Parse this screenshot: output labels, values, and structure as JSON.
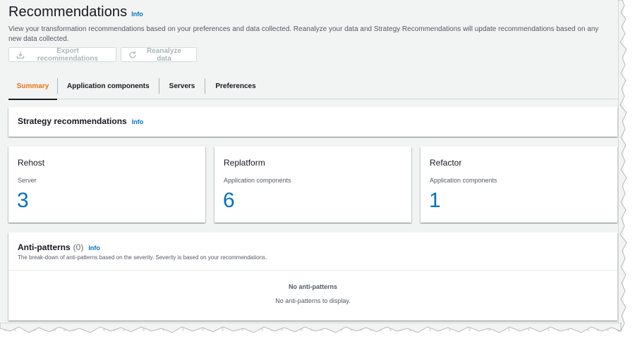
{
  "header": {
    "title": "Recommendations",
    "info": "Info",
    "description": "View your transformation recommendations based on your preferences and data collected. Reanalyze your data and Strategy Recommendations will update recommendations based on any new data collected."
  },
  "actions": {
    "export_label": "Export recommendations",
    "export_icon": "download-icon",
    "reanalyze_label": "Reanalyze data",
    "reanalyze_icon": "refresh-icon",
    "disabled_color": "#aab7b8"
  },
  "tabs": [
    {
      "label": "Summary",
      "active": true
    },
    {
      "label": "Application components",
      "active": false
    },
    {
      "label": "Servers",
      "active": false
    },
    {
      "label": "Preferences",
      "active": false
    }
  ],
  "strategy": {
    "title": "Strategy recommendations",
    "info": "Info"
  },
  "cards": [
    {
      "title": "Rehost",
      "subtitle": "Server",
      "value": "3"
    },
    {
      "title": "Replatform",
      "subtitle": "Application components",
      "value": "6"
    },
    {
      "title": "Refactor",
      "subtitle": "Application components",
      "value": "1"
    }
  ],
  "anti_patterns": {
    "title": "Anti-patterns",
    "count": "(0)",
    "info": "Info",
    "description": "The break-down of anti-patterns based on the severity. Severity is based on your recommendations.",
    "empty_title": "No anti-patterns",
    "empty_subtitle": "No anti-patterns to display."
  },
  "colors": {
    "accent": "#0073bb",
    "active_tab": "#ec7211",
    "background": "#f2f3f3"
  }
}
